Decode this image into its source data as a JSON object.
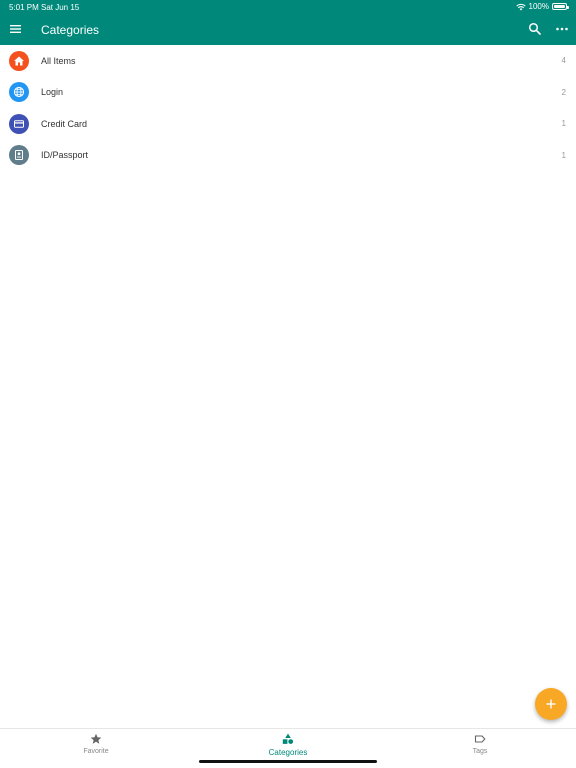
{
  "status_bar": {
    "time": "5:01 PM",
    "date": "Sat Jun 15",
    "battery": "100%"
  },
  "toolbar": {
    "title": "Categories",
    "menu_icon": "hamburger-menu-icon",
    "search_icon": "search-icon",
    "more_icon": "more-dots-icon",
    "color": "#00897b"
  },
  "categories": [
    {
      "label": "All Items",
      "count": "4",
      "icon": "home-icon",
      "color": "#f4511e"
    },
    {
      "label": "Login",
      "count": "2",
      "icon": "globe-icon",
      "color": "#2196f3"
    },
    {
      "label": "Credit Card",
      "count": "1",
      "icon": "credit-card-icon",
      "color": "#3f51b5"
    },
    {
      "label": "ID/Passport",
      "count": "1",
      "icon": "passport-icon",
      "color": "#607d8b"
    }
  ],
  "fab": {
    "icon": "plus-icon",
    "color": "#f9a825"
  },
  "bottom_nav": {
    "items": [
      {
        "label": "Favorite",
        "icon": "star-icon",
        "active": false
      },
      {
        "label": "Categories",
        "icon": "shapes-icon",
        "active": true
      },
      {
        "label": "Tags",
        "icon": "tag-icon",
        "active": false
      }
    ]
  }
}
